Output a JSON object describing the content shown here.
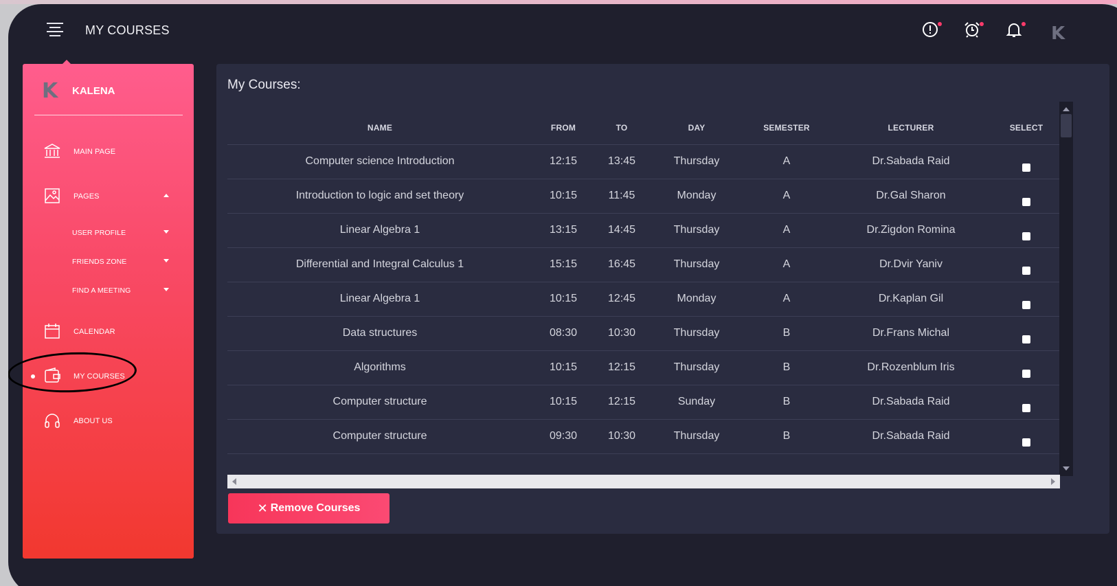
{
  "header": {
    "title": "MY COURSES",
    "icons": [
      "alert-icon",
      "alarm-clock-icon",
      "bell-icon"
    ],
    "avatar_letter": "K"
  },
  "sidebar": {
    "brand_letter": "K",
    "brand_name": "KALENA",
    "items": [
      {
        "label": "MAIN PAGE",
        "icon": "bank-icon"
      },
      {
        "label": "PAGES",
        "icon": "image-icon"
      },
      {
        "label": "USER PROFILE"
      },
      {
        "label": "FRIENDS ZONE"
      },
      {
        "label": "FIND A MEETING"
      },
      {
        "label": "CALENDAR",
        "icon": "calendar-icon"
      },
      {
        "label": "MY COURSES",
        "icon": "wallet-icon"
      },
      {
        "label": "ABOUT US",
        "icon": "headphones-icon"
      }
    ],
    "active": "MY COURSES"
  },
  "main": {
    "title": "My Courses:",
    "columns": [
      "NAME",
      "FROM",
      "TO",
      "DAY",
      "SEMESTER",
      "LECTURER",
      "SELECT"
    ],
    "rows": [
      {
        "name": "Computer science Introduction",
        "from": "12:15",
        "to": "13:45",
        "day": "Thursday",
        "semester": "A",
        "lecturer": "Dr.Sabada Raid"
      },
      {
        "name": "Introduction to logic and set theory",
        "from": "10:15",
        "to": "11:45",
        "day": "Monday",
        "semester": "A",
        "lecturer": "Dr.Gal Sharon"
      },
      {
        "name": "Linear Algebra 1",
        "from": "13:15",
        "to": "14:45",
        "day": "Thursday",
        "semester": "A",
        "lecturer": "Dr.Zigdon Romina"
      },
      {
        "name": "Differential and Integral Calculus 1",
        "from": "15:15",
        "to": "16:45",
        "day": "Thursday",
        "semester": "A",
        "lecturer": "Dr.Dvir Yaniv"
      },
      {
        "name": "Linear Algebra 1",
        "from": "10:15",
        "to": "12:45",
        "day": "Monday",
        "semester": "A",
        "lecturer": "Dr.Kaplan Gil"
      },
      {
        "name": "Data structures",
        "from": "08:30",
        "to": "10:30",
        "day": "Thursday",
        "semester": "B",
        "lecturer": "Dr.Frans Michal"
      },
      {
        "name": "Algorithms",
        "from": "10:15",
        "to": "12:15",
        "day": "Thursday",
        "semester": "B",
        "lecturer": "Dr.Rozenblum Iris"
      },
      {
        "name": "Computer structure",
        "from": "10:15",
        "to": "12:15",
        "day": "Sunday",
        "semester": "B",
        "lecturer": "Dr.Sabada Raid"
      },
      {
        "name": "Computer structure",
        "from": "09:30",
        "to": "10:30",
        "day": "Thursday",
        "semester": "B",
        "lecturer": "Dr.Sabada Raid"
      }
    ],
    "remove_button": "Remove Courses"
  },
  "colors": {
    "background": "#1f1f2d",
    "panel": "#2a2c40",
    "sidebar_top": "#ff5d8d",
    "sidebar_bottom": "#f2382f",
    "accent": "#f7365a"
  }
}
